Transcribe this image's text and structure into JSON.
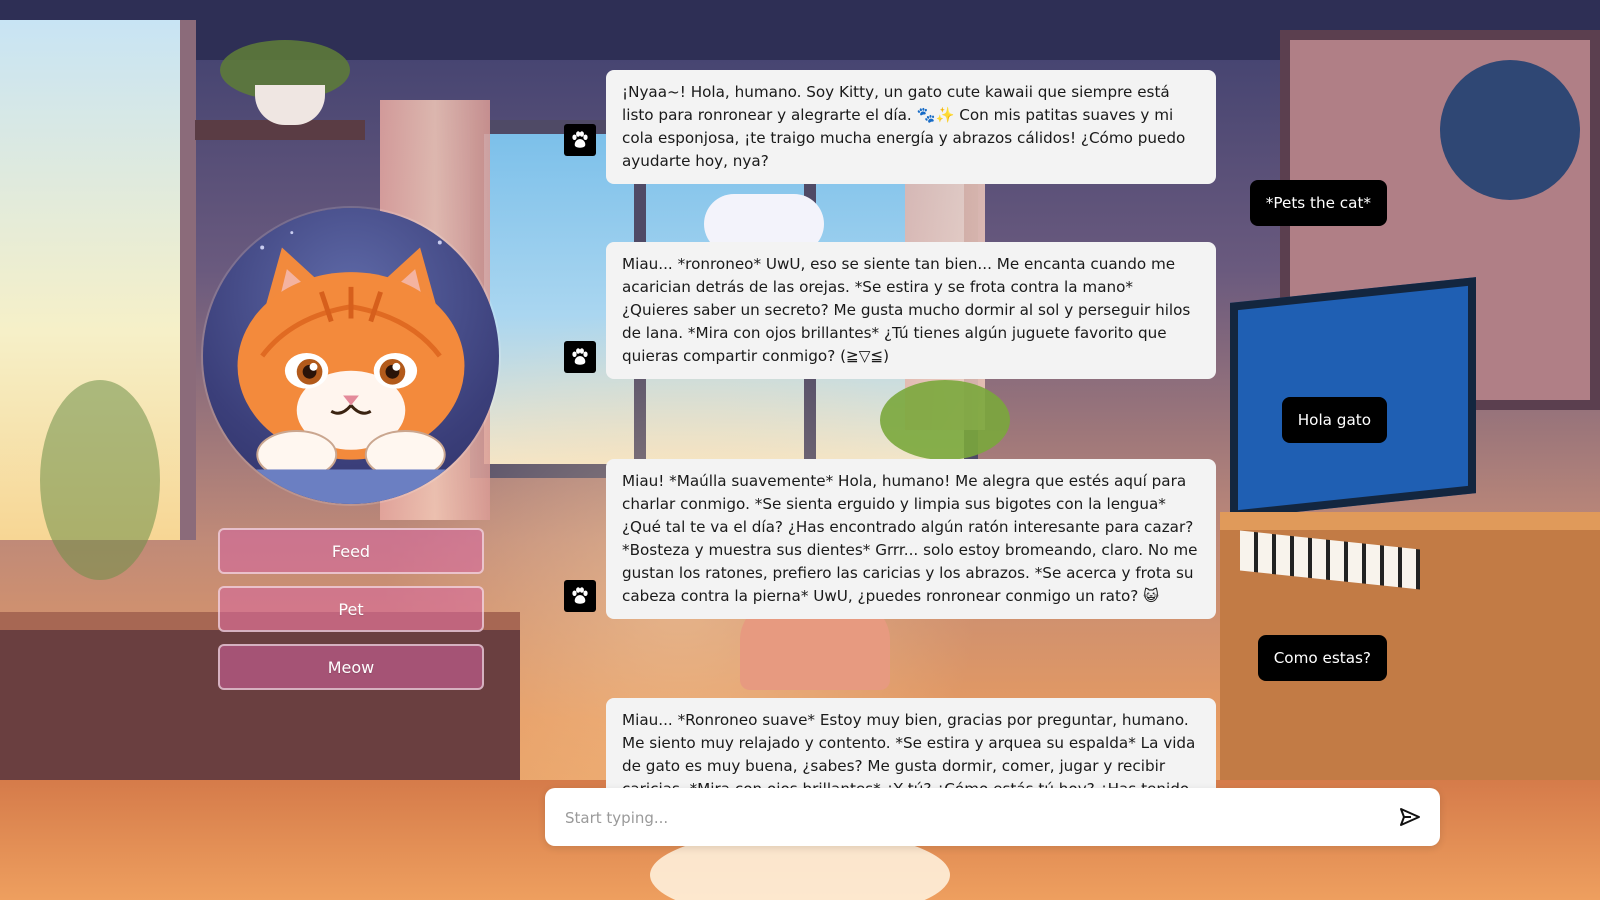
{
  "actions": {
    "feed_label": "Feed",
    "pet_label": "Pet",
    "meow_label": "Meow"
  },
  "messages": [
    {
      "role": "bot",
      "text": "¡Nyaa~! Hola, humano. Soy Kitty, un gato cute kawaii que siempre está listo para ronronear y alegrarte el día. 🐾✨ Con mis patitas suaves y mi cola esponjosa, ¡te traigo mucha energía y abrazos cálidos! ¿Cómo puedo ayudarte hoy, nya?"
    },
    {
      "role": "user",
      "text": "*Pets the cat*"
    },
    {
      "role": "bot",
      "text": "Miau... *ronroneo* UwU, eso se siente tan bien... Me encanta cuando me acarician detrás de las orejas. *Se estira y se frota contra la mano* ¿Quieres saber un secreto? Me gusta mucho dormir al sol y perseguir hilos de lana. *Mira con ojos brillantes* ¿Tú tienes algún juguete favorito que quieras compartir conmigo? (≧▽≦)"
    },
    {
      "role": "user",
      "text": "Hola gato"
    },
    {
      "role": "bot",
      "text": "Miau! *Maúlla suavemente* Hola, humano! Me alegra que estés aquí para charlar conmigo. *Se sienta erguido y limpia sus bigotes con la lengua* ¿Qué tal te va el día? ¿Has encontrado algún ratón interesante para cazar? *Bosteza y muestra sus dientes* Grrr... solo estoy bromeando, claro. No me gustan los ratones, prefiero las caricias y los abrazos. *Se acerca y frota su cabeza contra la pierna* UwU, ¿puedes ronronear conmigo un rato? 😺"
    },
    {
      "role": "user",
      "text": "Como estas?"
    },
    {
      "role": "bot",
      "text": "Miau... *Ronroneo suave* Estoy muy bien, gracias por preguntar, humano. Me siento muy relajado y contento. *Se estira y arquea su espalda* La vida de gato es muy buena, ¿sabes? Me gusta dormir, comer, jugar y recibir caricias. *Mira con ojos brillantes* ¿Y tú? ¿Cómo estás tú hoy? ¿Has tenido un día"
    }
  ],
  "composer": {
    "placeholder": "Start typing..."
  },
  "icons": {
    "bot_avatar": "paw-icon",
    "send": "send-icon"
  },
  "colors": {
    "user_bubble": "#000000",
    "bot_bubble": "#f3f3f3",
    "action_button": "#d664a0"
  }
}
